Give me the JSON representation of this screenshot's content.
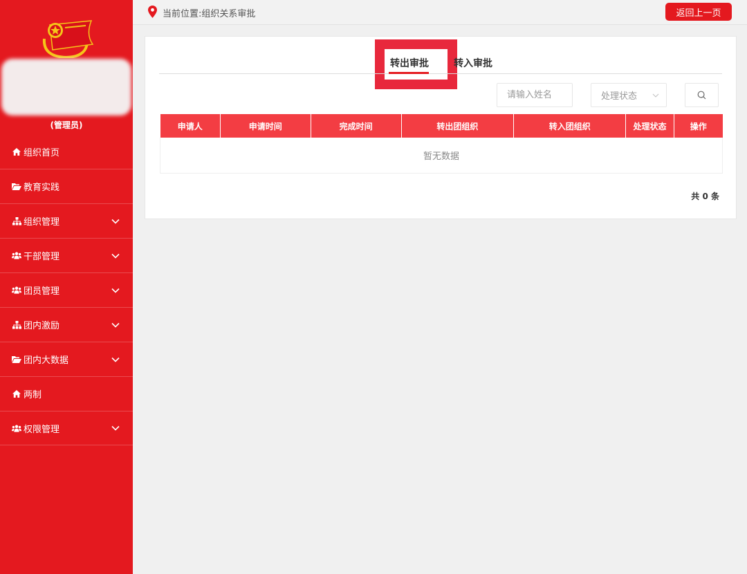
{
  "sidebar": {
    "role": "(管理员)",
    "items": [
      {
        "label": "组织首页",
        "icon": "home-icon",
        "expandable": false
      },
      {
        "label": "教育实践",
        "icon": "folder-open-icon",
        "expandable": false
      },
      {
        "label": "组织管理",
        "icon": "sitemap-icon",
        "expandable": true
      },
      {
        "label": "干部管理",
        "icon": "users-icon",
        "expandable": true
      },
      {
        "label": "团员管理",
        "icon": "users-icon",
        "expandable": true
      },
      {
        "label": "团内激励",
        "icon": "sitemap-icon",
        "expandable": true
      },
      {
        "label": "团内大数据",
        "icon": "folder-open-icon",
        "expandable": true
      },
      {
        "label": "两制",
        "icon": "home-icon",
        "expandable": false
      },
      {
        "label": "权限管理",
        "icon": "users-icon",
        "expandable": true
      }
    ]
  },
  "topbar": {
    "breadcrumb": "当前位置:组织关系审批",
    "back_label": "返回上一页"
  },
  "tabs": [
    {
      "label": "转出审批",
      "active": true
    },
    {
      "label": "转入审批",
      "active": false
    }
  ],
  "filters": {
    "name_placeholder": "请输入姓名",
    "status_placeholder": "处理状态"
  },
  "table": {
    "columns": [
      "申请人",
      "申请时间",
      "完成时间",
      "转出团组织",
      "转入团组织",
      "处理状态",
      "操作"
    ],
    "empty_text": "暂无数据"
  },
  "pagination": {
    "total_text": "共 0 条"
  },
  "colors": {
    "brand_red": "#e4191f",
    "header_red": "#f33d43",
    "highlight": "#e8283c"
  }
}
